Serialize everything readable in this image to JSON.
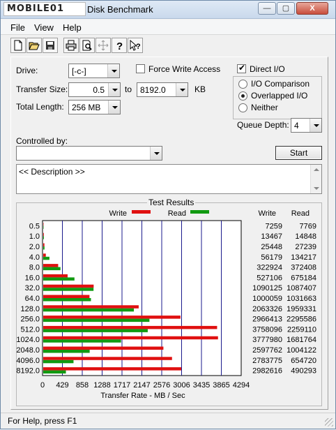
{
  "window": {
    "logo_text": "MOBILE01",
    "title": "Disk Benchmark",
    "title_prefix_visible": "Disk Benchmark",
    "minimize": "—",
    "maximize": "▢",
    "close": "X"
  },
  "menu": {
    "file": "File",
    "view": "View",
    "help": "Help"
  },
  "toolbar_icons": [
    "new-icon",
    "open-icon",
    "save-icon",
    "print-icon",
    "print-preview-icon",
    "move-icon",
    "help-icon",
    "context-help-icon"
  ],
  "form": {
    "drive_label": "Drive:",
    "drive_value": "[-c-]",
    "force_write_label": "Force Write Access",
    "force_write_checked": false,
    "direct_io_label": "Direct I/O",
    "direct_io_checked": true,
    "transfer_size_label": "Transfer Size:",
    "transfer_from": "0.5",
    "to_label": "to",
    "transfer_to": "8192.0",
    "kb_label": "KB",
    "total_length_label": "Total Length:",
    "total_length_value": "256 MB",
    "io_options": [
      {
        "label": "I/O Comparison",
        "checked": false
      },
      {
        "label": "Overlapped I/O",
        "checked": true
      },
      {
        "label": "Neither",
        "checked": false
      }
    ],
    "queue_depth_label": "Queue Depth:",
    "queue_depth_value": "4",
    "controlled_by_label": "Controlled by:",
    "controlled_by_value": "",
    "start_button": "Start",
    "description": "<< Description >>"
  },
  "results_title": "Test Results",
  "chart_data": {
    "type": "bar",
    "orientation": "horizontal",
    "categories": [
      "0.5",
      "1.0",
      "2.0",
      "4.0",
      "8.0",
      "16.0",
      "32.0",
      "64.0",
      "128.0",
      "256.0",
      "512.0",
      "1024.0",
      "2048.0",
      "4096.0",
      "8192.0"
    ],
    "series": [
      {
        "name": "Write",
        "color": "#e01010",
        "values": [
          7259,
          13467,
          25448,
          56179,
          322924,
          527106,
          1090125,
          1000059,
          2063326,
          2966413,
          3758096,
          3777980,
          2597762,
          2783775,
          2982616
        ]
      },
      {
        "name": "Read",
        "color": "#119a11",
        "values": [
          7769,
          14848,
          27239,
          134217,
          372408,
          675184,
          1087407,
          1031663,
          1959331,
          2295586,
          2259110,
          1681764,
          1004122,
          654720,
          490293
        ]
      }
    ],
    "legend_write": "Write",
    "legend_read": "Read",
    "col_header_write": "Write",
    "col_header_read": "Read",
    "x_ticks": [
      "0",
      "429",
      "858",
      "1288",
      "1717",
      "2147",
      "2576",
      "3006",
      "3435",
      "3865",
      "4294"
    ],
    "xlim": [
      0,
      4294
    ],
    "xlabel": "Transfer Rate - MB / Sec",
    "grid": true
  },
  "status": {
    "text": "For Help, press F1"
  }
}
